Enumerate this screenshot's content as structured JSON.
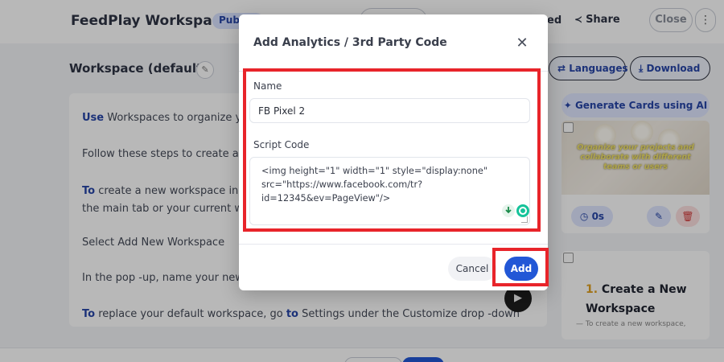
{
  "topbar": {
    "workspace_title": "FeedPlay Workspace",
    "badge": "Public",
    "shared_fragment": "ed",
    "share_label": "Share",
    "close_label": "Close",
    "more_label": "⋮"
  },
  "main": {
    "section_title": "Workspace (default)",
    "lines": [
      {
        "kw": "Use",
        "text": " Workspaces to organize yo"
      },
      {
        "kw": "",
        "text": "Follow these steps to create an"
      },
      {
        "kw": "To",
        "text": " create a new workspace in"
      },
      {
        "kw": "",
        "text": "the main tab or your current wo"
      },
      {
        "kw": "",
        "text": "Select Add New Workspace"
      },
      {
        "kw": "",
        "text": "In the pop -up, name your new"
      },
      {
        "kw": "To",
        "text": " replace your default workspace, go "
      }
    ],
    "last_line_kw2": "to",
    "last_line_tail": " Settings under the Customize drop -down"
  },
  "right_panel": {
    "languages_label": "Languages",
    "download_label": "Download",
    "generate_label": "Generate Cards using AI",
    "card1_caption": "Organize your projects and collaborate with different teams or users",
    "card1_timer": "0s",
    "card2_num": "1.",
    "card2_heading": " Create a New Workspace",
    "card2_sub": "— To create a new workspace,"
  },
  "modal": {
    "title": "Add Analytics / 3rd Party Code",
    "name_label": "Name",
    "name_value": "FB Pixel 2",
    "script_label": "Script Code",
    "script_value": "<img height=\"1\" width=\"1\" style=\"display:none\"\nsrc=\"https://www.facebook.com/tr?\nid=12345&ev=PageView\"/>",
    "cancel_label": "Cancel",
    "add_label": "Add"
  },
  "colors": {
    "primary": "#2257d6",
    "highlight": "#e8242a",
    "keyword": "#2746a8"
  }
}
